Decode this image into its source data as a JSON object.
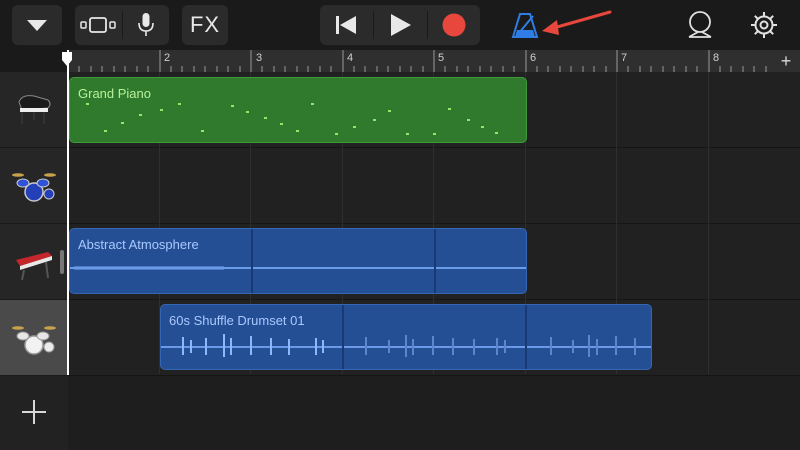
{
  "toolbar": {
    "fx_label": "FX",
    "buttons": [
      "browser-toggle",
      "track-view",
      "mic",
      "fx",
      "rewind",
      "play",
      "record",
      "metronome",
      "loop-browser",
      "settings"
    ]
  },
  "ruler": {
    "bar_numbers": [
      "2",
      "3",
      "4",
      "5",
      "6",
      "7",
      "8"
    ],
    "add_label": "+"
  },
  "tracks": [
    {
      "instrument": "Grand Piano",
      "icon": "grand-piano-icon"
    },
    {
      "instrument": "Drum Kit",
      "icon": "drum-kit-icon"
    },
    {
      "instrument": "Keyboard Synth",
      "icon": "keyboard-synth-icon"
    },
    {
      "instrument": "Drummer",
      "icon": "drummer-icon",
      "selected": true
    }
  ],
  "regions": {
    "grand_piano": "Grand Piano",
    "abstract_atmosphere": "Abstract Atmosphere",
    "shuffle_drums": "60s Shuffle Drumset 01"
  },
  "colors": {
    "midi_region": "#2f7a2c",
    "audio_region": "#244f94",
    "record": "#e8473d",
    "metronome": "#2f7ee6",
    "annotation_arrow": "#e8473d"
  }
}
